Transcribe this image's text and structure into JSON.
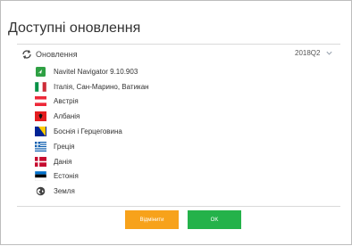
{
  "dialog": {
    "title": "Доступні оновлення",
    "header": {
      "label": "Оновлення",
      "version": "2018Q2"
    },
    "items": [
      {
        "label": "Navitel Navigator 9.10.903",
        "icon": "navitel-app-icon"
      },
      {
        "label": "Італія, Сан-Марино, Ватикан",
        "icon": "italy-flag-icon"
      },
      {
        "label": "Австрія",
        "icon": "austria-flag-icon"
      },
      {
        "label": "Албанія",
        "icon": "albania-flag-icon"
      },
      {
        "label": "Боснія і Герцеговина",
        "icon": "bosnia-flag-icon"
      },
      {
        "label": "Греція",
        "icon": "greece-flag-icon"
      },
      {
        "label": "Данія",
        "icon": "denmark-flag-icon"
      },
      {
        "label": "Естонія",
        "icon": "estonia-flag-icon"
      },
      {
        "label": "Земля",
        "icon": "globe-icon"
      }
    ],
    "buttons": {
      "cancel": "Відмінити",
      "ok": "OK"
    }
  },
  "colors": {
    "cancel": "#f7a21b",
    "ok": "#24b24a"
  }
}
